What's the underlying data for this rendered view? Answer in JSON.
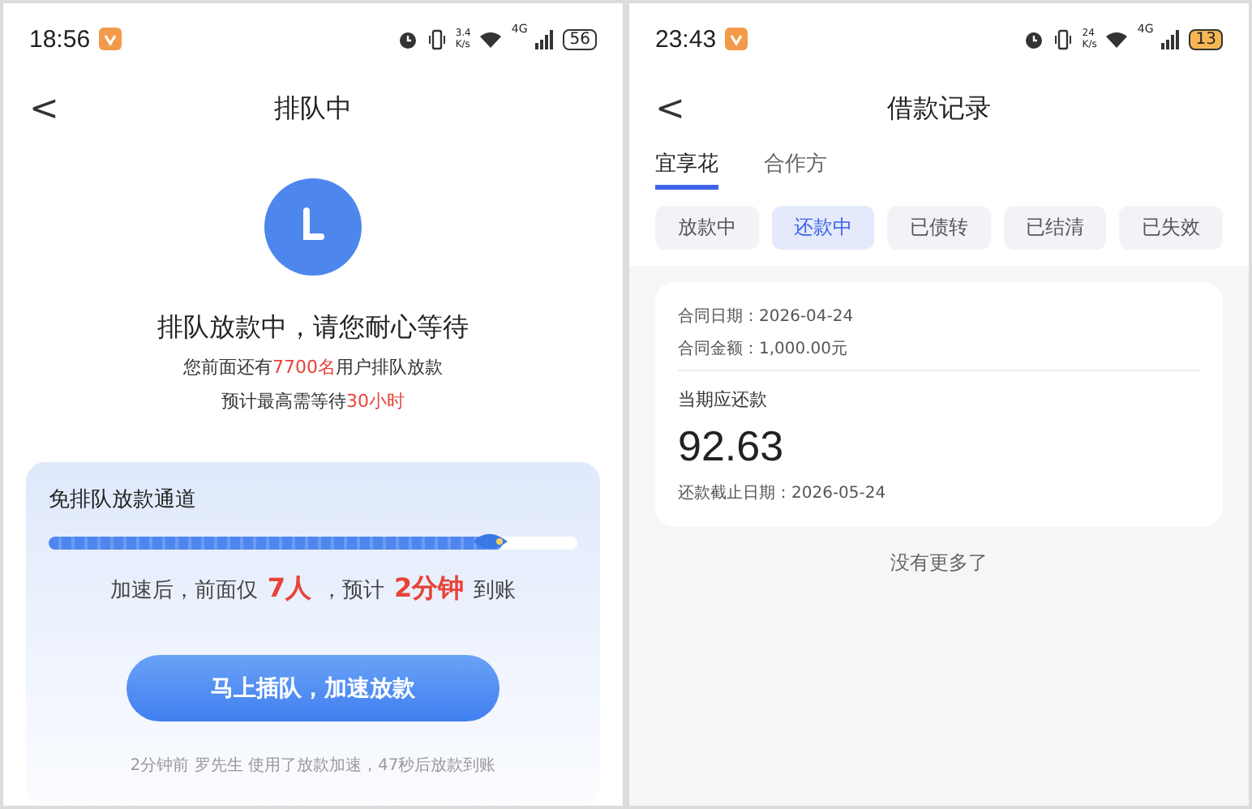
{
  "queue_screen": {
    "status_bar": {
      "time": "18:56",
      "speed": [
        "3.4",
        "K/s"
      ],
      "network": "4G",
      "battery": "56",
      "battery_low": false
    },
    "nav": {
      "back": "<",
      "title": "排队中"
    },
    "heading": "排队放款中，请您耐心等待",
    "lines": [
      [
        {
          "text": "您前面还有",
          "highlight": false
        },
        {
          "text": "7700名",
          "highlight": true
        },
        {
          "text": "用户排队放款",
          "highlight": false
        }
      ],
      [
        {
          "text": "预计最高需等待",
          "highlight": false
        },
        {
          "text": "30小时",
          "highlight": true
        }
      ]
    ],
    "fast_lane": {
      "title": "免排队放款通道",
      "level": 0.86,
      "summary": [
        {
          "text": "加速后，前面仅",
          "highlight": false
        },
        {
          "text": "7人",
          "highlight": true
        },
        {
          "text": "，预计",
          "highlight": false
        },
        {
          "text": "2分钟",
          "highlight": true
        },
        {
          "text": "到账",
          "highlight": false
        }
      ],
      "button": "马上插队，加速放款",
      "footer": "2分钟前 罗先生 使用了放款加速，47秒后放款到账"
    }
  },
  "records_screen": {
    "status_bar": {
      "time": "23:43",
      "speed": [
        "24",
        "K/s"
      ],
      "network": "4G",
      "battery": "13",
      "battery_low": true
    },
    "nav": {
      "back": "<",
      "title": "借款记录"
    },
    "tabs": [
      {
        "label": "宜享花",
        "selected": true
      },
      {
        "label": "合作方",
        "selected": false
      }
    ],
    "filters": [
      {
        "label": "放款中",
        "selected": false
      },
      {
        "label": "还款中",
        "selected": true
      },
      {
        "label": "已债转",
        "selected": false
      },
      {
        "label": "已结清",
        "selected": false
      },
      {
        "label": "已失效",
        "selected": false
      }
    ],
    "record": {
      "contract_date": "合同日期：2026-04-24",
      "contract_amount": "合同金额：1,000.00元",
      "due_label": "当期应还款",
      "due_amount": "92.63",
      "due_date": "还款截止日期：2026-05-24"
    },
    "end_note": "没有更多了"
  }
}
